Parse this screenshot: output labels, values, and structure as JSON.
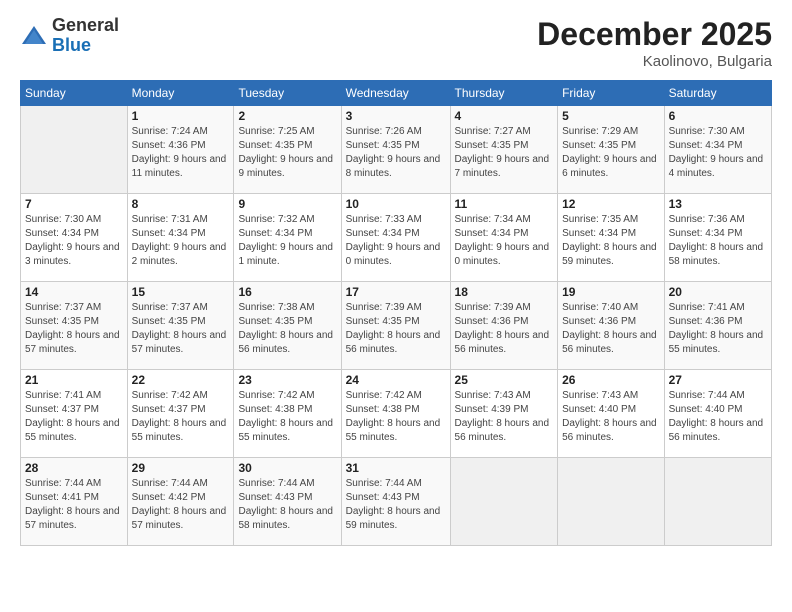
{
  "header": {
    "logo_general": "General",
    "logo_blue": "Blue",
    "month_title": "December 2025",
    "location": "Kaolinovo, Bulgaria"
  },
  "weekdays": [
    "Sunday",
    "Monday",
    "Tuesday",
    "Wednesday",
    "Thursday",
    "Friday",
    "Saturday"
  ],
  "weeks": [
    [
      {
        "day": "",
        "sunrise": "",
        "sunset": "",
        "daylight": ""
      },
      {
        "day": "1",
        "sunrise": "Sunrise: 7:24 AM",
        "sunset": "Sunset: 4:36 PM",
        "daylight": "Daylight: 9 hours and 11 minutes."
      },
      {
        "day": "2",
        "sunrise": "Sunrise: 7:25 AM",
        "sunset": "Sunset: 4:35 PM",
        "daylight": "Daylight: 9 hours and 9 minutes."
      },
      {
        "day": "3",
        "sunrise": "Sunrise: 7:26 AM",
        "sunset": "Sunset: 4:35 PM",
        "daylight": "Daylight: 9 hours and 8 minutes."
      },
      {
        "day": "4",
        "sunrise": "Sunrise: 7:27 AM",
        "sunset": "Sunset: 4:35 PM",
        "daylight": "Daylight: 9 hours and 7 minutes."
      },
      {
        "day": "5",
        "sunrise": "Sunrise: 7:29 AM",
        "sunset": "Sunset: 4:35 PM",
        "daylight": "Daylight: 9 hours and 6 minutes."
      },
      {
        "day": "6",
        "sunrise": "Sunrise: 7:30 AM",
        "sunset": "Sunset: 4:34 PM",
        "daylight": "Daylight: 9 hours and 4 minutes."
      }
    ],
    [
      {
        "day": "7",
        "sunrise": "Sunrise: 7:30 AM",
        "sunset": "Sunset: 4:34 PM",
        "daylight": "Daylight: 9 hours and 3 minutes."
      },
      {
        "day": "8",
        "sunrise": "Sunrise: 7:31 AM",
        "sunset": "Sunset: 4:34 PM",
        "daylight": "Daylight: 9 hours and 2 minutes."
      },
      {
        "day": "9",
        "sunrise": "Sunrise: 7:32 AM",
        "sunset": "Sunset: 4:34 PM",
        "daylight": "Daylight: 9 hours and 1 minute."
      },
      {
        "day": "10",
        "sunrise": "Sunrise: 7:33 AM",
        "sunset": "Sunset: 4:34 PM",
        "daylight": "Daylight: 9 hours and 0 minutes."
      },
      {
        "day": "11",
        "sunrise": "Sunrise: 7:34 AM",
        "sunset": "Sunset: 4:34 PM",
        "daylight": "Daylight: 9 hours and 0 minutes."
      },
      {
        "day": "12",
        "sunrise": "Sunrise: 7:35 AM",
        "sunset": "Sunset: 4:34 PM",
        "daylight": "Daylight: 8 hours and 59 minutes."
      },
      {
        "day": "13",
        "sunrise": "Sunrise: 7:36 AM",
        "sunset": "Sunset: 4:34 PM",
        "daylight": "Daylight: 8 hours and 58 minutes."
      }
    ],
    [
      {
        "day": "14",
        "sunrise": "Sunrise: 7:37 AM",
        "sunset": "Sunset: 4:35 PM",
        "daylight": "Daylight: 8 hours and 57 minutes."
      },
      {
        "day": "15",
        "sunrise": "Sunrise: 7:37 AM",
        "sunset": "Sunset: 4:35 PM",
        "daylight": "Daylight: 8 hours and 57 minutes."
      },
      {
        "day": "16",
        "sunrise": "Sunrise: 7:38 AM",
        "sunset": "Sunset: 4:35 PM",
        "daylight": "Daylight: 8 hours and 56 minutes."
      },
      {
        "day": "17",
        "sunrise": "Sunrise: 7:39 AM",
        "sunset": "Sunset: 4:35 PM",
        "daylight": "Daylight: 8 hours and 56 minutes."
      },
      {
        "day": "18",
        "sunrise": "Sunrise: 7:39 AM",
        "sunset": "Sunset: 4:36 PM",
        "daylight": "Daylight: 8 hours and 56 minutes."
      },
      {
        "day": "19",
        "sunrise": "Sunrise: 7:40 AM",
        "sunset": "Sunset: 4:36 PM",
        "daylight": "Daylight: 8 hours and 56 minutes."
      },
      {
        "day": "20",
        "sunrise": "Sunrise: 7:41 AM",
        "sunset": "Sunset: 4:36 PM",
        "daylight": "Daylight: 8 hours and 55 minutes."
      }
    ],
    [
      {
        "day": "21",
        "sunrise": "Sunrise: 7:41 AM",
        "sunset": "Sunset: 4:37 PM",
        "daylight": "Daylight: 8 hours and 55 minutes."
      },
      {
        "day": "22",
        "sunrise": "Sunrise: 7:42 AM",
        "sunset": "Sunset: 4:37 PM",
        "daylight": "Daylight: 8 hours and 55 minutes."
      },
      {
        "day": "23",
        "sunrise": "Sunrise: 7:42 AM",
        "sunset": "Sunset: 4:38 PM",
        "daylight": "Daylight: 8 hours and 55 minutes."
      },
      {
        "day": "24",
        "sunrise": "Sunrise: 7:42 AM",
        "sunset": "Sunset: 4:38 PM",
        "daylight": "Daylight: 8 hours and 55 minutes."
      },
      {
        "day": "25",
        "sunrise": "Sunrise: 7:43 AM",
        "sunset": "Sunset: 4:39 PM",
        "daylight": "Daylight: 8 hours and 56 minutes."
      },
      {
        "day": "26",
        "sunrise": "Sunrise: 7:43 AM",
        "sunset": "Sunset: 4:40 PM",
        "daylight": "Daylight: 8 hours and 56 minutes."
      },
      {
        "day": "27",
        "sunrise": "Sunrise: 7:44 AM",
        "sunset": "Sunset: 4:40 PM",
        "daylight": "Daylight: 8 hours and 56 minutes."
      }
    ],
    [
      {
        "day": "28",
        "sunrise": "Sunrise: 7:44 AM",
        "sunset": "Sunset: 4:41 PM",
        "daylight": "Daylight: 8 hours and 57 minutes."
      },
      {
        "day": "29",
        "sunrise": "Sunrise: 7:44 AM",
        "sunset": "Sunset: 4:42 PM",
        "daylight": "Daylight: 8 hours and 57 minutes."
      },
      {
        "day": "30",
        "sunrise": "Sunrise: 7:44 AM",
        "sunset": "Sunset: 4:43 PM",
        "daylight": "Daylight: 8 hours and 58 minutes."
      },
      {
        "day": "31",
        "sunrise": "Sunrise: 7:44 AM",
        "sunset": "Sunset: 4:43 PM",
        "daylight": "Daylight: 8 hours and 59 minutes."
      },
      {
        "day": "",
        "sunrise": "",
        "sunset": "",
        "daylight": ""
      },
      {
        "day": "",
        "sunrise": "",
        "sunset": "",
        "daylight": ""
      },
      {
        "day": "",
        "sunrise": "",
        "sunset": "",
        "daylight": ""
      }
    ]
  ]
}
